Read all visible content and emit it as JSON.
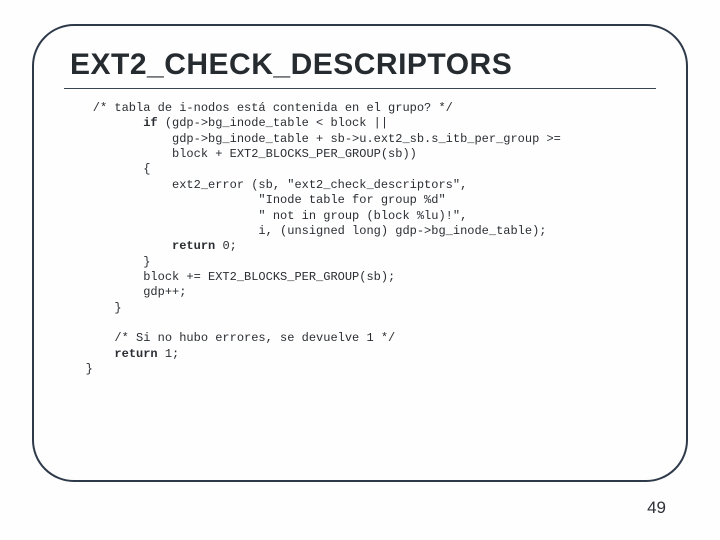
{
  "slide": {
    "title": "EXT2_CHECK_DESCRIPTORS",
    "page_number": "49",
    "code": {
      "l01": "    /* tabla de i-nodos está contenida en el grupo? */",
      "l02_kw": "if",
      "l02_rest": " (gdp->bg_inode_table < block ||",
      "l03": "               gdp->bg_inode_table + sb->u.ext2_sb.s_itb_per_group >=",
      "l04": "               block + EXT2_BLOCKS_PER_GROUP(sb))",
      "l05": "           {",
      "l06": "               ext2_error (sb, \"ext2_check_descriptors\",",
      "l07": "                           \"Inode table for group %d\"",
      "l08": "                           \" not in group (block %lu)!\",",
      "l09": "                           i, (unsigned long) gdp->bg_inode_table);",
      "l10_kw": "return",
      "l10_rest": " 0;",
      "l11": "           }",
      "l12": "           block += EXT2_BLOCKS_PER_GROUP(sb);",
      "l13": "           gdp++;",
      "l14": "       }",
      "l15": "",
      "l16": "       /* Si no hubo errores, se devuelve 1 */",
      "l17_kw": "return",
      "l17_rest": " 1;",
      "l18": "   }"
    }
  }
}
